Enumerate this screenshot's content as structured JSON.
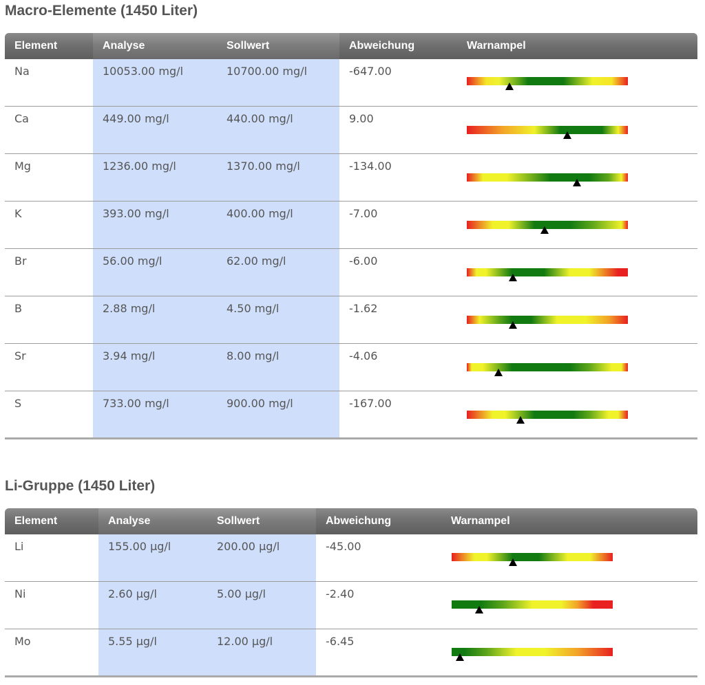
{
  "sections": [
    {
      "title": "Macro-Elemente (1450 Liter)",
      "headers": {
        "element": "Element",
        "analyse": "Analyse",
        "sollwert": "Sollwert",
        "abweichung": "Abweichung",
        "warnampel": "Warnampel"
      },
      "rows": [
        {
          "element": "Na",
          "analyse": "10053.00 mg/l",
          "sollwert": "10700.00 mg/l",
          "abweichung": "-647.00",
          "gradient": [
            "#e82020 0%",
            "#f5e528 12%",
            "#eef232 20%",
            "#5ea61a 32%",
            "#117a11 38%",
            "#117a11 60%",
            "#f0f22a 78%",
            "#f5e528 90%",
            "#e82020 100%"
          ],
          "marker": 0.265
        },
        {
          "element": "Ca",
          "analyse": "449.00 mg/l",
          "sollwert": "440.00 mg/l",
          "abweichung": "9.00",
          "gradient": [
            "#e82020 0%",
            "#f2a328 22%",
            "#f0f22a 42%",
            "#117a11 58%",
            "#117a11 84%",
            "#f0f22a 94%",
            "#e82020 100%"
          ],
          "marker": 0.625
        },
        {
          "element": "Mg",
          "analyse": "1236.00 mg/l",
          "sollwert": "1370.00 mg/l",
          "abweichung": "-134.00",
          "gradient": [
            "#e82020 0%",
            "#f0f22a 10%",
            "#f0f22a 25%",
            "#117a11 52%",
            "#117a11 76%",
            "#5ea61a 88%",
            "#f0f22a 96%",
            "#e82020 100%"
          ],
          "marker": 0.685
        },
        {
          "element": "K",
          "analyse": "393.00 mg/l",
          "sollwert": "400.00 mg/l",
          "abweichung": "-7.00",
          "gradient": [
            "#e82020 0%",
            "#f0f22a 16%",
            "#f0f22a 26%",
            "#117a11 42%",
            "#117a11 64%",
            "#5ea61a 78%",
            "#f0f22a 96%",
            "#e82020 100%"
          ],
          "marker": 0.485
        },
        {
          "element": "Br",
          "analyse": "56.00 mg/l",
          "sollwert": "62.00 mg/l",
          "abweichung": "-6.00",
          "gradient": [
            "#e82020 0%",
            "#f0f22a 6%",
            "#f0f22a 12%",
            "#117a11 28%",
            "#117a11 48%",
            "#f0f22a 64%",
            "#f0f22a 76%",
            "#e82020 94%",
            "#e82020 100%"
          ],
          "marker": 0.285
        },
        {
          "element": "B",
          "analyse": "2.88 mg/l",
          "sollwert": "4.50 mg/l",
          "abweichung": "-1.62",
          "gradient": [
            "#e82020 0%",
            "#f0f22a 8%",
            "#5ea61a 20%",
            "#117a11 28%",
            "#117a11 40%",
            "#f0f22a 56%",
            "#f0f22a 74%",
            "#f2a328 88%",
            "#e82020 100%"
          ],
          "marker": 0.285
        },
        {
          "element": "Sr",
          "analyse": "3.94 mg/l",
          "sollwert": "8.00 mg/l",
          "abweichung": "-4.06",
          "gradient": [
            "#e82020 0%",
            "#f0f22a 3%",
            "#f0f22a 10%",
            "#117a11 28%",
            "#117a11 64%",
            "#5ea61a 76%",
            "#f0f22a 90%",
            "#f0f22a 96%",
            "#e82020 100%"
          ],
          "marker": 0.195
        },
        {
          "element": "S",
          "analyse": "733.00 mg/l",
          "sollwert": "900.00 mg/l",
          "abweichung": "-167.00",
          "gradient": [
            "#e82020 0%",
            "#f0f22a 16%",
            "#f0f22a 24%",
            "#117a11 42%",
            "#117a11 66%",
            "#5ea61a 76%",
            "#f0f22a 88%",
            "#f0f22a 94%",
            "#e82020 100%"
          ],
          "marker": 0.335
        }
      ]
    },
    {
      "title": "Li-Gruppe (1450 Liter)",
      "headers": {
        "element": "Element",
        "analyse": "Analyse",
        "sollwert": "Sollwert",
        "abweichung": "Abweichung",
        "warnampel": "Warnampel"
      },
      "rows": [
        {
          "element": "Li",
          "analyse": "155.00 µg/l",
          "sollwert": "200.00 µg/l",
          "abweichung": "-45.00",
          "gradient": [
            "#e82020 0%",
            "#f0f22a 14%",
            "#f0f22a 22%",
            "#117a11 38%",
            "#117a11 54%",
            "#f0f22a 72%",
            "#f0f22a 86%",
            "#e82020 100%"
          ],
          "marker": 0.38
        },
        {
          "element": "Ni",
          "analyse": "2.60 µg/l",
          "sollwert": "5.00 µg/l",
          "abweichung": "-2.40",
          "gradient": [
            "#117a11 0%",
            "#117a11 18%",
            "#5ea61a 32%",
            "#f0f22a 50%",
            "#f0f22a 68%",
            "#f2a328 78%",
            "#e82020 88%",
            "#e82020 100%"
          ],
          "marker": 0.17
        },
        {
          "element": "Mo",
          "analyse": "5.55 µg/l",
          "sollwert": "12.00 µg/l",
          "abweichung": "-6.45",
          "gradient": [
            "#117a11 0%",
            "#117a11 8%",
            "#5ea61a 22%",
            "#f0f22a 40%",
            "#f0f22a 58%",
            "#f2a328 78%",
            "#e82020 100%"
          ],
          "marker": 0.05
        }
      ]
    }
  ]
}
